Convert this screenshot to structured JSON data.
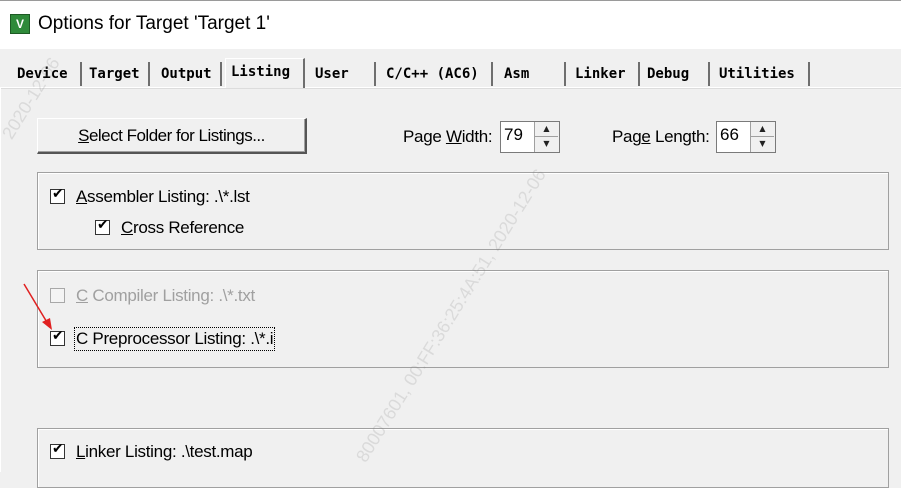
{
  "window": {
    "title": "Options for Target 'Target 1'",
    "icon": "uvision-app-icon"
  },
  "tabs": [
    {
      "label": "Device",
      "active": false
    },
    {
      "label": "Target",
      "active": false
    },
    {
      "label": "Output",
      "active": false
    },
    {
      "label": "Listing",
      "active": true
    },
    {
      "label": "User",
      "active": false
    },
    {
      "label": "C/C++ (AC6)",
      "active": false
    },
    {
      "label": "Asm",
      "active": false
    },
    {
      "label": "Linker",
      "active": false
    },
    {
      "label": "Debug",
      "active": false
    },
    {
      "label": "Utilities",
      "active": false
    }
  ],
  "listing": {
    "select_folder_button": {
      "prefix": "S",
      "rest": "elect Folder for Listings..."
    },
    "page_width": {
      "label_pre": "Page ",
      "label_u": "W",
      "label_post": "idth:",
      "value": "79"
    },
    "page_length": {
      "label_pre": "Pag",
      "label_u": "e",
      "label_post": " Length:",
      "value": "66"
    },
    "assembler_listing": {
      "u": "A",
      "label": "ssembler Listing:  .\\*.lst",
      "checked": true
    },
    "cross_reference": {
      "u": "C",
      "label": "ross Reference",
      "checked": true
    },
    "c_compiler_listing": {
      "u": "C",
      "label": " Compiler Listing:  .\\*.txt",
      "checked": false,
      "enabled": false
    },
    "c_preprocessor_listing": {
      "label": "C Preprocessor Listing:  .\\*.i",
      "checked": true
    },
    "linker_listing": {
      "u": "L",
      "label": "inker Listing:  .\\test.map",
      "checked": true
    }
  },
  "annotation": {
    "color": "#e02020",
    "icon": "red-arrow-annotation"
  },
  "watermarks": [
    "2020-12-06",
    "80007601, 00:FF:36:25:4A:51, 2020-12-06"
  ]
}
